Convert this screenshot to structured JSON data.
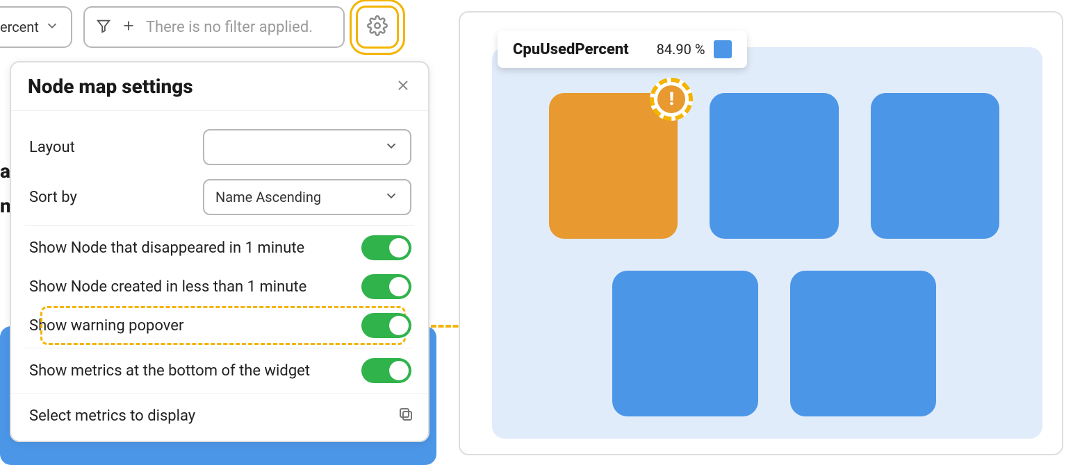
{
  "toolbar": {
    "mode_partial": "ercent",
    "filter_placeholder": "There is no filter applied."
  },
  "bg": {
    "frag1": "al",
    "frag2": "nt"
  },
  "popover": {
    "title": "Node map settings",
    "layout_label": "Layout",
    "layout_value": "",
    "sortby_label": "Sort by",
    "sortby_value": "Name Ascending",
    "toggles": [
      {
        "label": "Show Node that disappeared in 1 minute",
        "on": true
      },
      {
        "label": "Show Node created in less than 1 minute",
        "on": true
      },
      {
        "label": "Show warning popover",
        "on": true,
        "highlighted": true
      },
      {
        "label": "Show metrics at the bottom of the widget",
        "on": true
      }
    ],
    "select_metrics": "Select metrics to display"
  },
  "widget": {
    "metric_name": "CpuUsedPercent",
    "metric_value": "84.90 %",
    "colors": {
      "normal": "#4c96e8",
      "warn": "#e8992f"
    }
  }
}
